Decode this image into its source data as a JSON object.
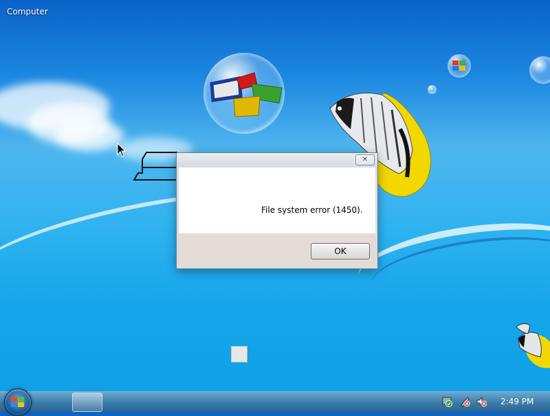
{
  "desktop": {
    "computer_label": "Computer"
  },
  "dialog": {
    "title": "",
    "close_symbol": "✕",
    "message": "File system error (1450).",
    "ok_label": "OK"
  },
  "taskbar": {
    "start_icon": "windows-start-orb-icon",
    "tray_icons": [
      "security-check-icon",
      "network-icon",
      "volume-muted-icon"
    ],
    "clock": "2:49 PM"
  },
  "colors": {
    "desktop_sky": "#1b86e0",
    "dialog_bg": "#d8dde3",
    "dialog_footer": "#e3ddd6"
  }
}
